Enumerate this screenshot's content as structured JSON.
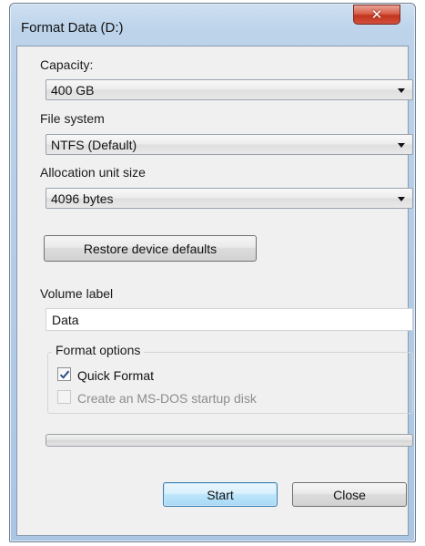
{
  "window": {
    "title": "Format Data (D:)",
    "close_glyph": "✕",
    "close_icon": "close-icon"
  },
  "capacity": {
    "label": "Capacity:",
    "value": "400 GB"
  },
  "file_system": {
    "label": "File system",
    "value": "NTFS (Default)"
  },
  "allocation": {
    "label": "Allocation unit size",
    "value": "4096 bytes"
  },
  "restore_button": "Restore device defaults",
  "volume": {
    "label": "Volume label",
    "value": "Data"
  },
  "format_options": {
    "title": "Format options",
    "quick_format": {
      "label": "Quick Format",
      "checked": true
    },
    "ms_dos": {
      "label": "Create an MS-DOS startup disk",
      "checked": false,
      "enabled": false
    }
  },
  "progress": {
    "percent": 0
  },
  "buttons": {
    "start": "Start",
    "close": "Close"
  }
}
